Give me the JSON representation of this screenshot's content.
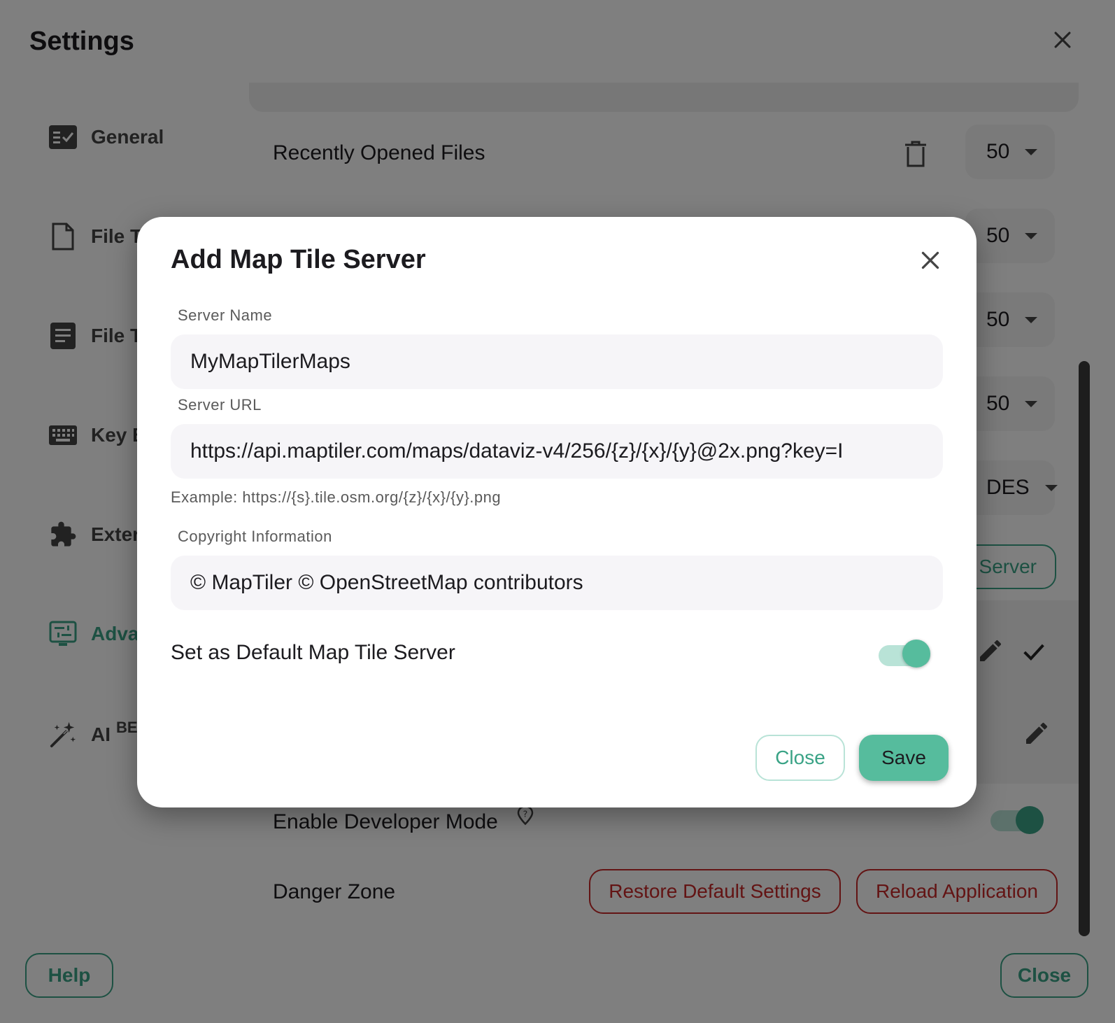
{
  "settings": {
    "title": "Settings",
    "nav": [
      {
        "label": "General",
        "icon": "checklist-icon"
      },
      {
        "label": "File T",
        "icon": "file-icon"
      },
      {
        "label": "File T",
        "icon": "document-lines-icon"
      },
      {
        "label": "Key B",
        "icon": "keyboard-icon"
      },
      {
        "label": "Exter",
        "icon": "puzzle-icon"
      },
      {
        "label": "Adva",
        "icon": "advanced-settings-icon",
        "active": true
      },
      {
        "label": "AI",
        "badge": "BE",
        "icon": "magic-wand-icon"
      }
    ],
    "recently_opened_label": "Recently Opened Files",
    "selects": [
      "50",
      "50",
      "50",
      "50",
      "DES"
    ],
    "server_button_label": "Server",
    "developer_mode_label": "Enable Developer Mode",
    "danger_zone_label": "Danger Zone",
    "restore_label": "Restore Default Settings",
    "reload_label": "Reload Application",
    "help_label": "Help",
    "close_label": "Close"
  },
  "modal": {
    "title": "Add Map Tile Server",
    "server_name_label": "Server Name",
    "server_name_value": "MyMapTilerMaps",
    "server_url_label": "Server URL",
    "server_url_value": "https://api.maptiler.com/maps/dataviz-v4/256/{z}/{x}/{y}@2x.png?key=I",
    "server_url_hint": "Example: https://{s}.tile.osm.org/{z}/{x}/{y}.png",
    "copyright_label": "Copyright Information",
    "copyright_value": "© MapTiler © OpenStreetMap contributors",
    "default_label": "Set as Default Map Tile Server",
    "default_on": true,
    "close_label": "Close",
    "save_label": "Save"
  },
  "colors": {
    "accent": "#3aa386",
    "save_bg": "#56bc9d",
    "danger": "#c62828"
  }
}
